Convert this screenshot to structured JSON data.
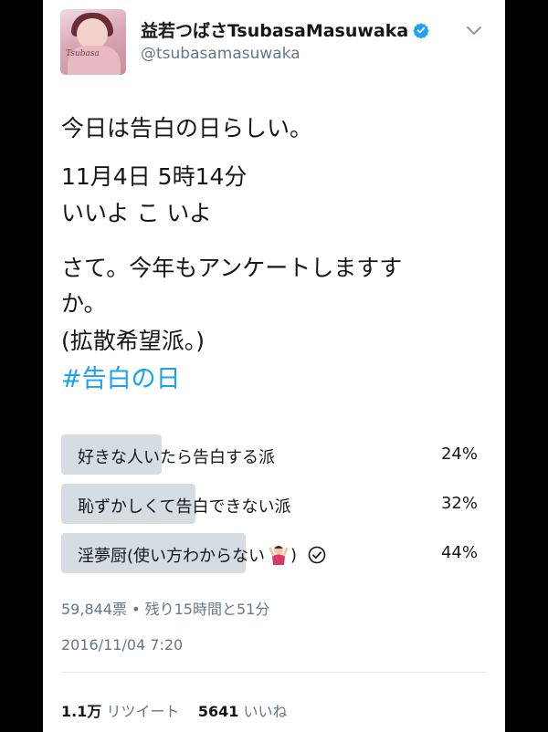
{
  "tweet": {
    "author_name": "益若つばさTsubasaMasuwaka",
    "handle": "@tsubasamasuwaka",
    "avatar_signature": "Tsubasa",
    "lines": [
      "今日は告白の日らしい。",
      "11月4日 5時14分",
      "いいよ こ いよ",
      "さて。今年もアンケートしますす",
      "か。",
      "(拡散希望派。)"
    ],
    "hashtag": "#告白の日",
    "date": "2016/11/04 7:20"
  },
  "poll": {
    "options": [
      {
        "label": "好きな人いたら告白する派",
        "percent_text": "24%",
        "percent": 24
      },
      {
        "label": "恥ずかしくて告白できない派",
        "percent_text": "32%",
        "percent": 32
      },
      {
        "label": "淫夢厨(使い方わからない",
        "label_end": ")",
        "percent_text": "44%",
        "percent": 44,
        "selected": true
      }
    ],
    "votes": "59,844票",
    "separator": "•",
    "time_left": "残り15時間と51分"
  },
  "stats": {
    "retweets_count": "1.1万",
    "retweets_label": "リツイート",
    "likes_count": "5641",
    "likes_label": "いいね"
  },
  "colors": {
    "hashtag": "#1da1f2",
    "verified": "#1da1f2",
    "poll_bar": "#d6dde2",
    "secondary_text": "#657786"
  },
  "icons": [
    "verified-badge-icon",
    "chevron-down-icon",
    "vote-check-icon",
    "emoji-icon"
  ]
}
